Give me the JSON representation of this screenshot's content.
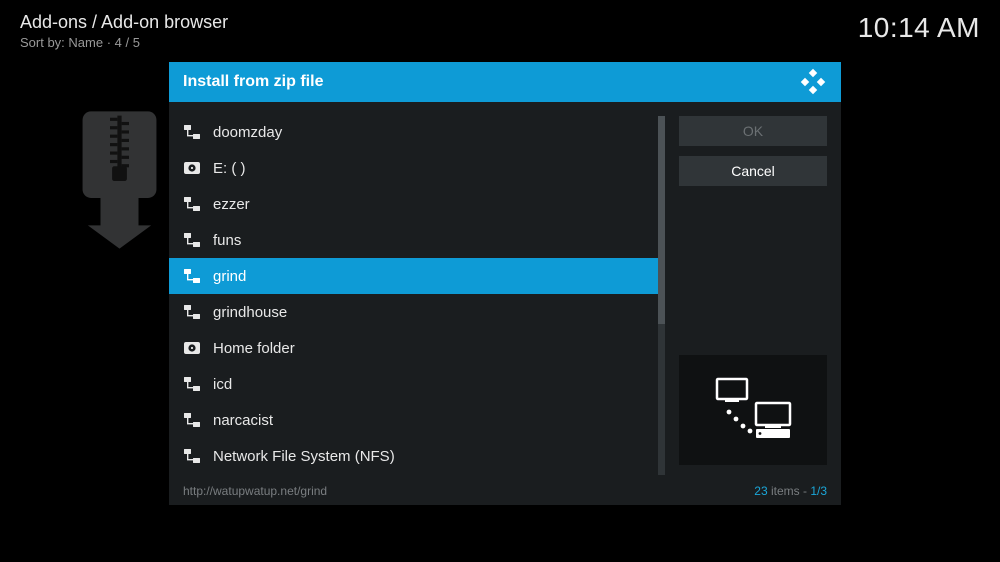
{
  "header": {
    "breadcrumb": "Add-ons / Add-on browser",
    "sortBy": "Sort by: Name  ·  4 / 5",
    "clock": "10:14 AM"
  },
  "dialog": {
    "title": "Install from zip file",
    "buttons": {
      "ok": "OK",
      "cancel": "Cancel"
    },
    "items": [
      {
        "icon": "net",
        "label": "doomzday"
      },
      {
        "icon": "disk",
        "label": "E: ( )"
      },
      {
        "icon": "net",
        "label": "ezzer"
      },
      {
        "icon": "net",
        "label": "funs"
      },
      {
        "icon": "net",
        "label": "grind"
      },
      {
        "icon": "net",
        "label": "grindhouse"
      },
      {
        "icon": "disk",
        "label": "Home folder"
      },
      {
        "icon": "net",
        "label": "icd"
      },
      {
        "icon": "net",
        "label": "narcacist"
      },
      {
        "icon": "net",
        "label": "Network File System (NFS)"
      }
    ],
    "selectedIndex": 4,
    "footer": {
      "path": "http://watupwatup.net/grind",
      "count": "23",
      "suffix": " items - ",
      "pos": "1/3"
    }
  }
}
